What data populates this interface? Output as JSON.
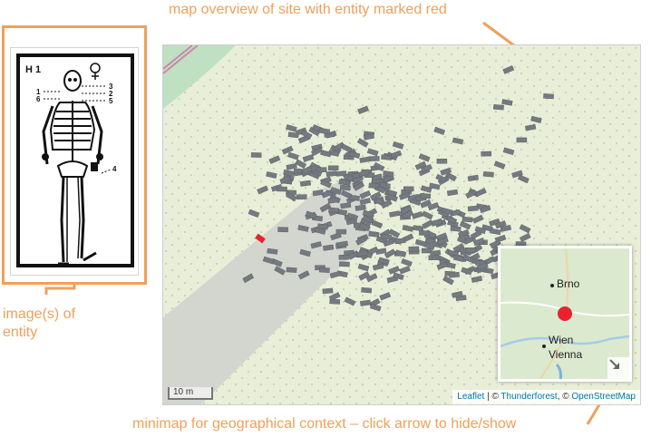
{
  "annotations": {
    "map_overview": "map overview of site with entity marked red",
    "entity_images": "image(s) of entity",
    "minimap_help": "minimap for geographical context – click arrow to hide/show"
  },
  "entity_image": {
    "grave_label": "H 1",
    "callout_numbers": [
      "1",
      "2",
      "3",
      "4",
      "5",
      "6"
    ]
  },
  "map": {
    "scale_label": "10 m",
    "attribution": {
      "leaflet": "Leaflet",
      "separator": " | © ",
      "thunderforest": "Thunderforest",
      "separator2": ", © ",
      "osm": "OpenStreetMap"
    },
    "colors": {
      "background": "#e8eed8",
      "road": "#d3d5cf",
      "grave": "#757a80",
      "highlight": "#e8232e"
    }
  },
  "minimap": {
    "cities": {
      "brno": "Brno",
      "wien": "Wien",
      "vienna": "Vienna"
    },
    "marker_color": "#e8232e",
    "toggle_icon": "arrow-collapse-icon"
  }
}
